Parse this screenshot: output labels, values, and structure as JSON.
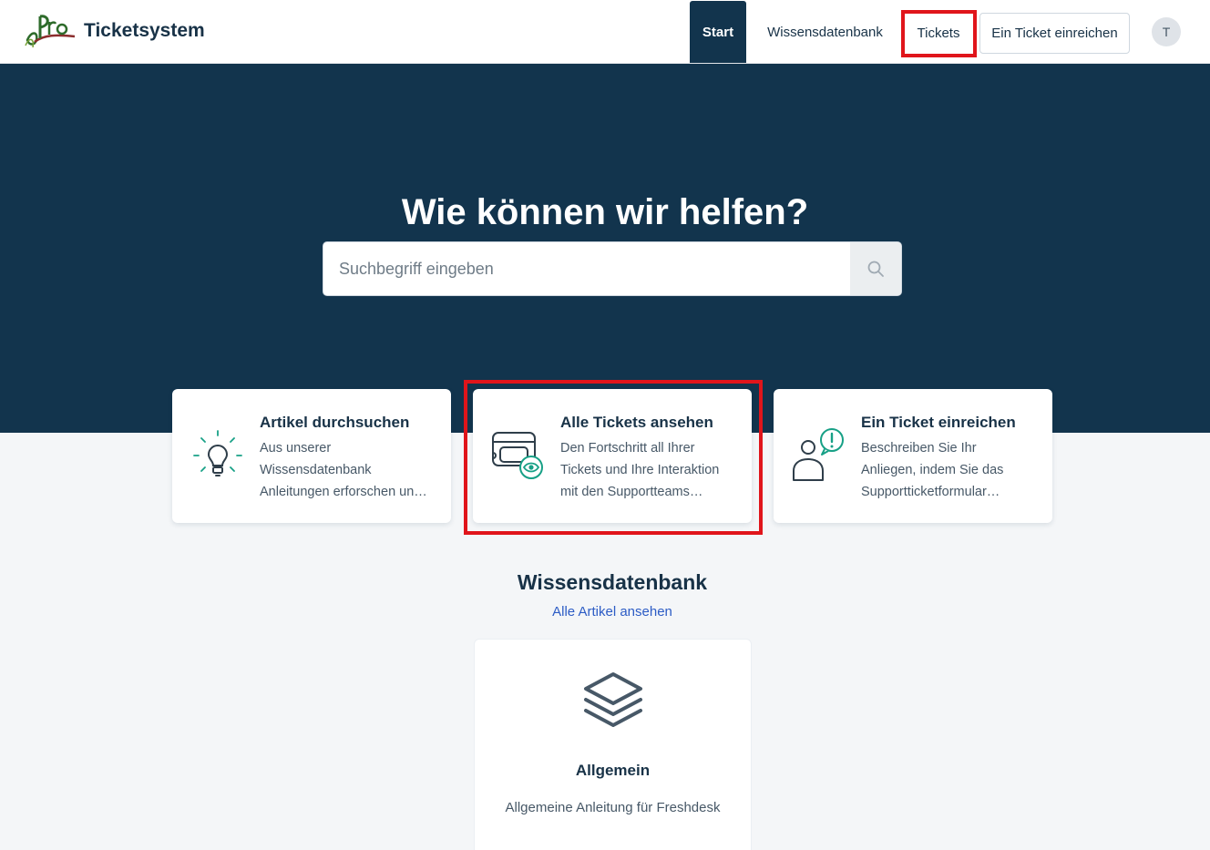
{
  "header": {
    "brand": "Ticketsystem",
    "nav": {
      "start": "Start",
      "knowledge_base": "Wissensdatenbank",
      "tickets": "Tickets",
      "submit_ticket": "Ein Ticket einreichen"
    },
    "avatar_initial": "T"
  },
  "hero": {
    "title": "Wie können wir helfen?",
    "search_placeholder": "Suchbegriff eingeben"
  },
  "cards": [
    {
      "title": "Artikel durchsuchen",
      "desc_lines": [
        "Aus unserer",
        "Wissensdatenbank",
        "Anleitungen erforschen un…"
      ],
      "icon": "lightbulb-icon"
    },
    {
      "title": "Alle Tickets ansehen",
      "desc_lines": [
        "Den Fortschritt all Ihrer",
        "Tickets und Ihre Interaktion",
        "mit den Supportteams…"
      ],
      "icon": "tickets-eye-icon"
    },
    {
      "title": "Ein Ticket einreichen",
      "desc_lines": [
        "Beschreiben Sie Ihr",
        "Anliegen, indem Sie das",
        "Supportticketformular…"
      ],
      "icon": "person-alert-icon"
    }
  ],
  "knowledge_base": {
    "title": "Wissensdatenbank",
    "link": "Alle Artikel ansehen",
    "categories": [
      {
        "title": "Allgemein",
        "desc": "Allgemeine Anleitung für Freshdesk",
        "icon": "layers-icon"
      }
    ]
  },
  "colors": {
    "primary": "#12344d",
    "accent": "#17a086",
    "highlight": "#e0151b",
    "link": "#2c5cc5"
  }
}
